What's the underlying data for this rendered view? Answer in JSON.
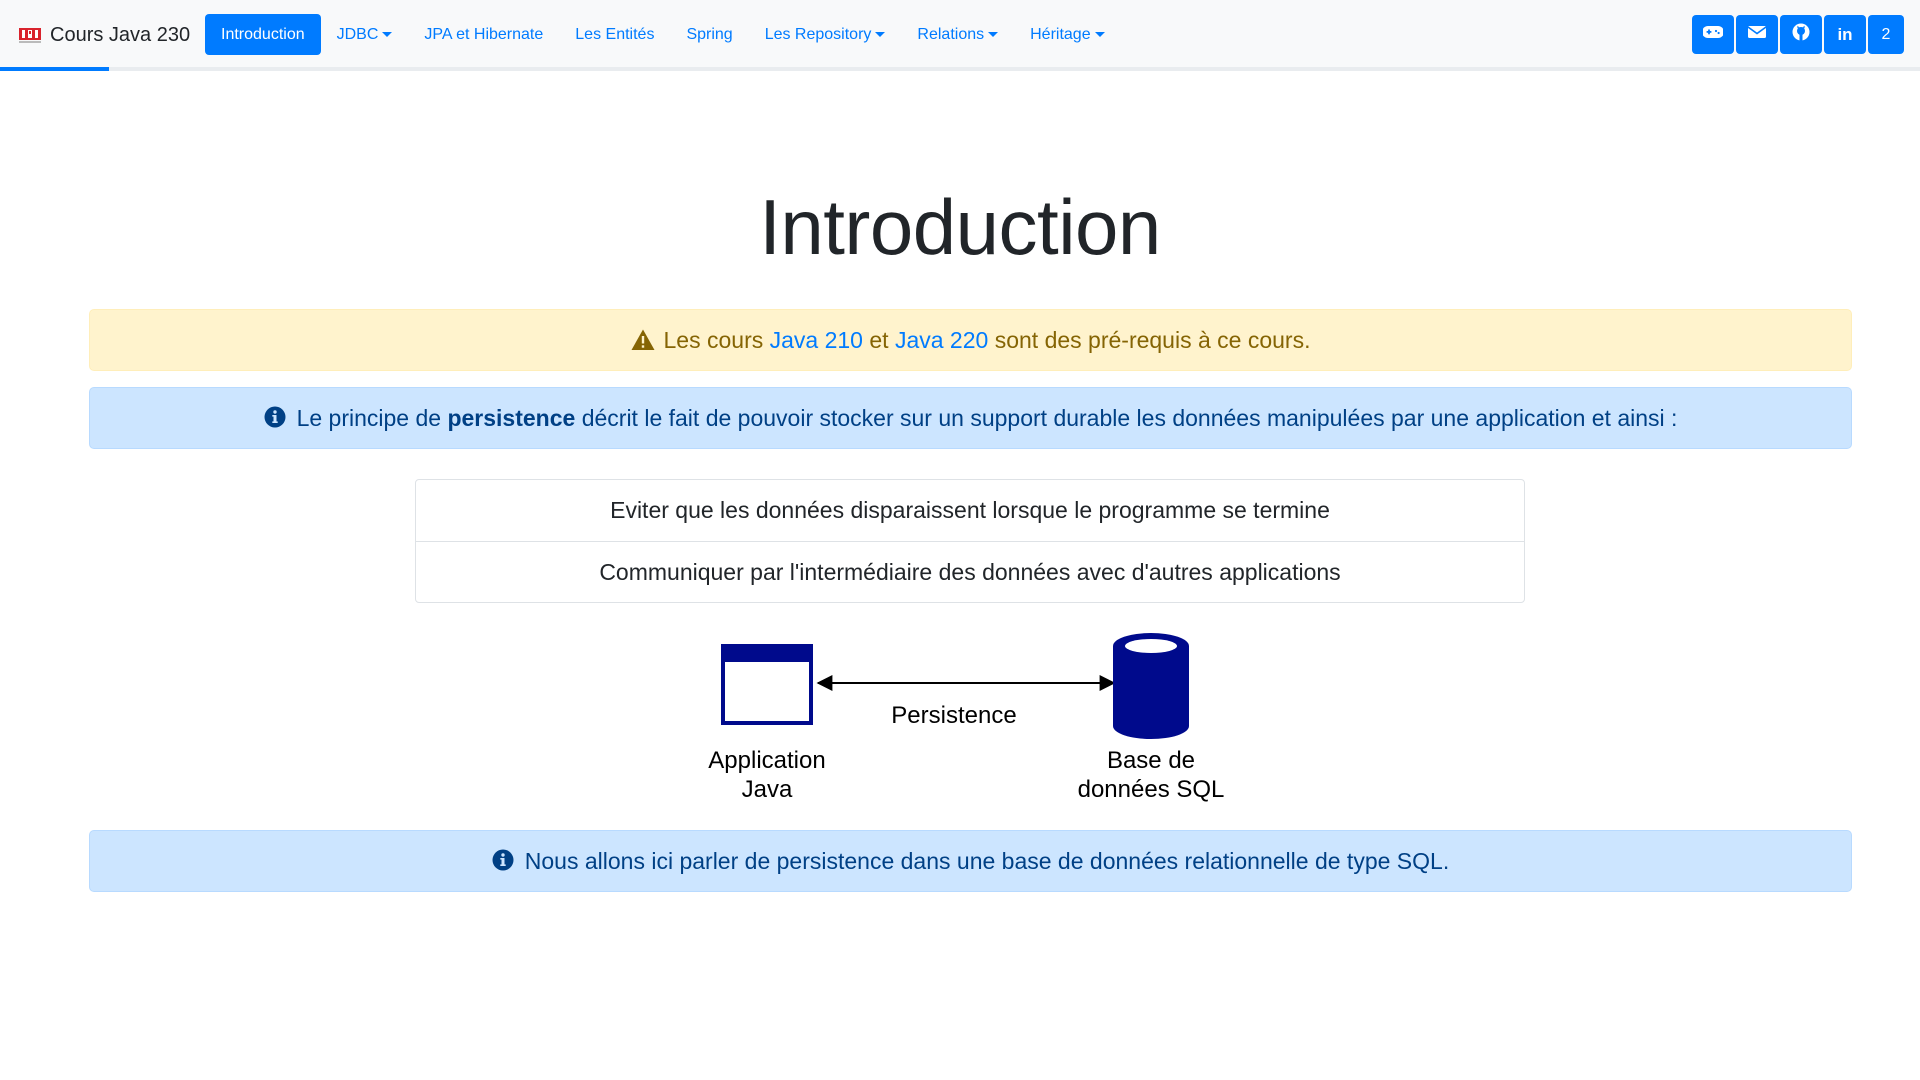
{
  "brand": {
    "title": "Cours Java 230",
    "logo_icon": "ipi-logo-icon"
  },
  "progress": {
    "fraction": 0.057
  },
  "nav": {
    "items": [
      {
        "label": "Introduction",
        "active": true,
        "dropdown": false
      },
      {
        "label": "JDBC",
        "active": false,
        "dropdown": true
      },
      {
        "label": "JPA et Hibernate",
        "active": false,
        "dropdown": false
      },
      {
        "label": "Les Entités",
        "active": false,
        "dropdown": false
      },
      {
        "label": "Spring",
        "active": false,
        "dropdown": false
      },
      {
        "label": "Les Repository",
        "active": false,
        "dropdown": true
      },
      {
        "label": "Relations",
        "active": false,
        "dropdown": true
      },
      {
        "label": "Héritage",
        "active": false,
        "dropdown": true
      }
    ]
  },
  "toolbar": {
    "icons": [
      "gamepad-icon",
      "envelope-icon",
      "github-icon",
      "linkedin-icon"
    ],
    "linkedin_label": "in",
    "slide_number": "2"
  },
  "main": {
    "title": "Introduction",
    "warning": {
      "icon": "warning-icon",
      "prefix": "Les cours",
      "link1": "Java 210",
      "middle": "et",
      "link2": "Java 220",
      "suffix": "sont des pré-requis à ce cours."
    },
    "info1": {
      "icon": "info-icon",
      "prefix": "Le principe de",
      "strong": "persistence",
      "suffix": "décrit le fait de pouvoir stocker sur un support durable les données manipulées par une application et ainsi :"
    },
    "list": [
      "Eviter que les données disparaissent lorsque le programme se termine",
      "Communiquer par l'intermédiaire des données avec d'autres applications"
    ],
    "diagram": {
      "app_label_line1": "Application",
      "app_label_line2": "Java",
      "arrow_label": "Persistence",
      "db_label_line1": "Base de",
      "db_label_line2": "données SQL"
    },
    "info2": {
      "icon": "info-icon",
      "text": "Nous allons ici parler de persistence dans une base de données relationnelle de type SQL."
    }
  },
  "colors": {
    "primary": "#007bff",
    "warning_bg": "#fff3cd",
    "warning_text": "#856404",
    "info_bg": "#cce5ff",
    "info_text": "#004085",
    "diagram_navy": "#000a8c"
  }
}
